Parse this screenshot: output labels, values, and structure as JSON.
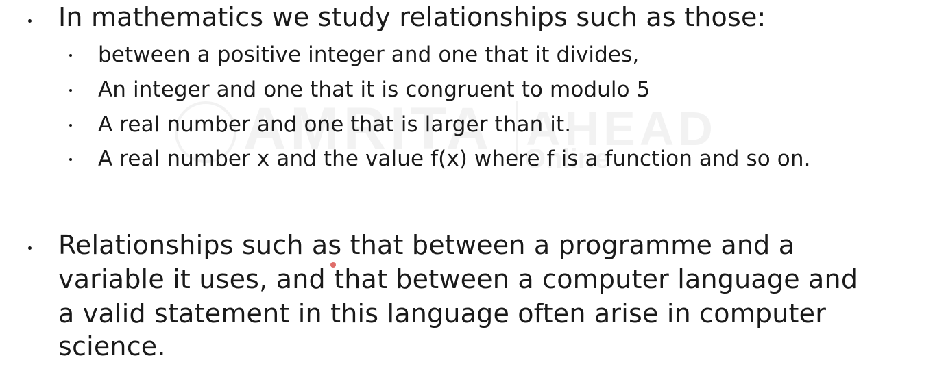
{
  "slide": {
    "bullet1": {
      "text": "In mathematics we study relationships such as those:",
      "sub_items": [
        "between a positive integer and one that it divides,",
        "An integer and one that it is congruent to modulo 5",
        "A real number and one that is larger than it.",
        "A real number x and the value f(x) where f is a function and so on."
      ]
    },
    "bullet2": {
      "lines": [
        "Relationships such as that between a programme and a",
        "variable it uses, and that between a computer language and",
        "a valid statement in this language often arise in computer",
        "science."
      ]
    },
    "watermark": {
      "word": "AMRITA",
      "word2": "AHEAD",
      "small": "Online"
    }
  }
}
